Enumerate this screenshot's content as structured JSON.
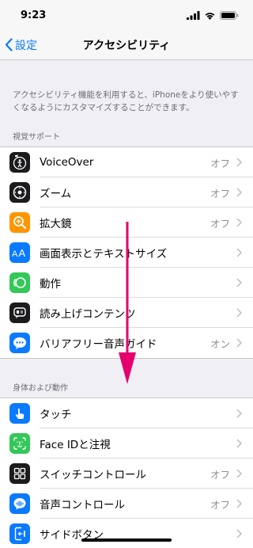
{
  "status": {
    "time": "9:23"
  },
  "nav": {
    "back_label": "設定",
    "title": "アクセシビリティ"
  },
  "description": "アクセシビリティ機能を利用すると、iPhoneをより使いやすくなるようにカスタマイズすることができます。",
  "sections": [
    {
      "header": "視覚サポート",
      "items": [
        {
          "label": "VoiceOver",
          "value": "オフ",
          "icon": "voiceover-icon",
          "color": "#1c1c1e"
        },
        {
          "label": "ズーム",
          "value": "オフ",
          "icon": "zoom-icon",
          "color": "#1c1c1e"
        },
        {
          "label": "拡大鏡",
          "value": "オフ",
          "icon": "magnifier-icon",
          "color": "#ff9500"
        },
        {
          "label": "画面表示とテキストサイズ",
          "value": "",
          "icon": "text-size-icon",
          "color": "#0a7aff"
        },
        {
          "label": "動作",
          "value": "",
          "icon": "motion-icon",
          "color": "#34c759"
        },
        {
          "label": "読み上げコンテンツ",
          "value": "",
          "icon": "spoken-content-icon",
          "color": "#1c1c1e"
        },
        {
          "label": "バリアフリー音声ガイド",
          "value": "オン",
          "icon": "audio-description-icon",
          "color": "#0a7aff"
        }
      ]
    },
    {
      "header": "身体および動作",
      "items": [
        {
          "label": "タッチ",
          "value": "",
          "icon": "touch-icon",
          "color": "#0a7aff"
        },
        {
          "label": "Face IDと注視",
          "value": "",
          "icon": "face-id-icon",
          "color": "#34c759"
        },
        {
          "label": "スイッチコントロール",
          "value": "オフ",
          "icon": "switch-control-icon",
          "color": "#1c1c1e"
        },
        {
          "label": "音声コントロール",
          "value": "オフ",
          "icon": "voice-control-icon",
          "color": "#0a7aff"
        },
        {
          "label": "サイドボタン",
          "value": "",
          "icon": "side-button-icon",
          "color": "#0a7aff"
        }
      ]
    }
  ],
  "arrow_color": "#e5006e"
}
